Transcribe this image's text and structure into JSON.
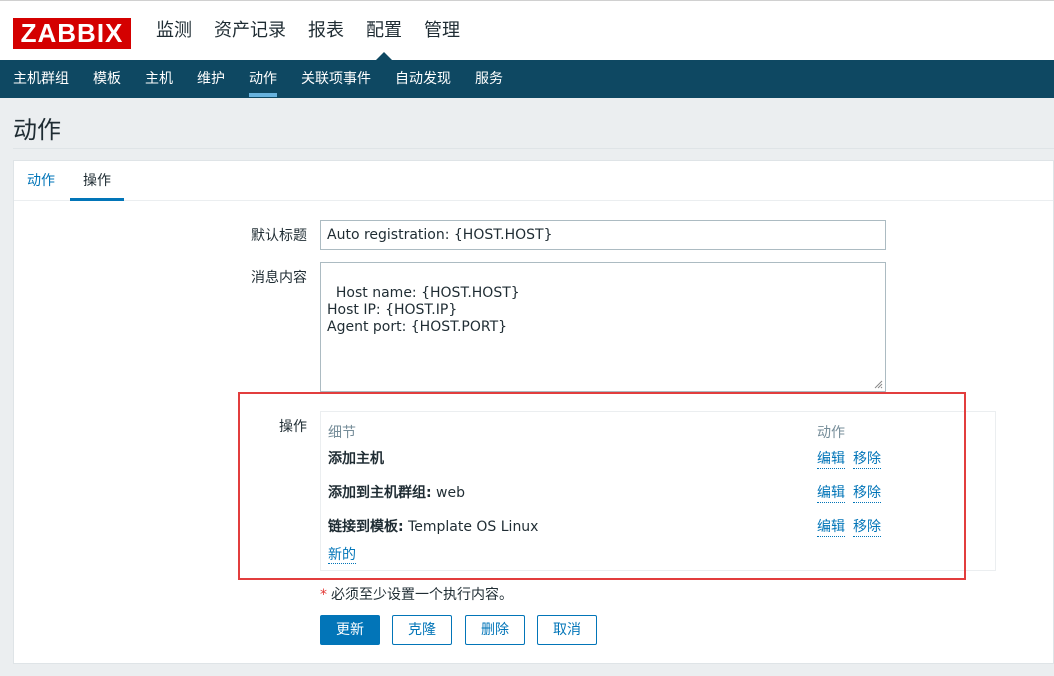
{
  "app": {
    "logo": "ZABBIX"
  },
  "main_menu": [
    {
      "label": "监测",
      "selected": false
    },
    {
      "label": "资产记录",
      "selected": false
    },
    {
      "label": "报表",
      "selected": false
    },
    {
      "label": "配置",
      "selected": true
    },
    {
      "label": "管理",
      "selected": false
    }
  ],
  "sub_menu": [
    {
      "label": "主机群组",
      "selected": false
    },
    {
      "label": "模板",
      "selected": false
    },
    {
      "label": "主机",
      "selected": false
    },
    {
      "label": "维护",
      "selected": false
    },
    {
      "label": "动作",
      "selected": true
    },
    {
      "label": "关联项事件",
      "selected": false
    },
    {
      "label": "自动发现",
      "selected": false
    },
    {
      "label": "服务",
      "selected": false
    }
  ],
  "page": {
    "title": "动作"
  },
  "tabs": [
    {
      "label": "动作",
      "active": false
    },
    {
      "label": "操作",
      "active": true
    }
  ],
  "form": {
    "default_subject_label": "默认标题",
    "default_subject_value": "Auto registration: {HOST.HOST}",
    "message_label": "消息内容",
    "message_value": "Host name: {HOST.HOST}\nHost IP: {HOST.IP}\nAgent port: {HOST.PORT}",
    "operations_label": "操作"
  },
  "operations": {
    "header_details": "细节",
    "header_action": "动作",
    "rows": [
      {
        "title": "添加主机",
        "detail": "",
        "edit": "编辑",
        "remove": "移除"
      },
      {
        "title": "添加到主机群组:",
        "detail": " web",
        "edit": "编辑",
        "remove": "移除"
      },
      {
        "title": "链接到模板:",
        "detail": " Template OS Linux",
        "edit": "编辑",
        "remove": "移除"
      }
    ],
    "new_link": "新的"
  },
  "required_note": {
    "star": "*",
    "text": "必须至少设置一个执行内容。"
  },
  "buttons": {
    "update": "更新",
    "clone": "克隆",
    "delete": "删除",
    "cancel": "取消"
  },
  "colors": {
    "brand_red": "#d40000",
    "nav_dark": "#0e4862",
    "accent_blue": "#0275b8",
    "highlight_frame": "#e23d3d"
  }
}
